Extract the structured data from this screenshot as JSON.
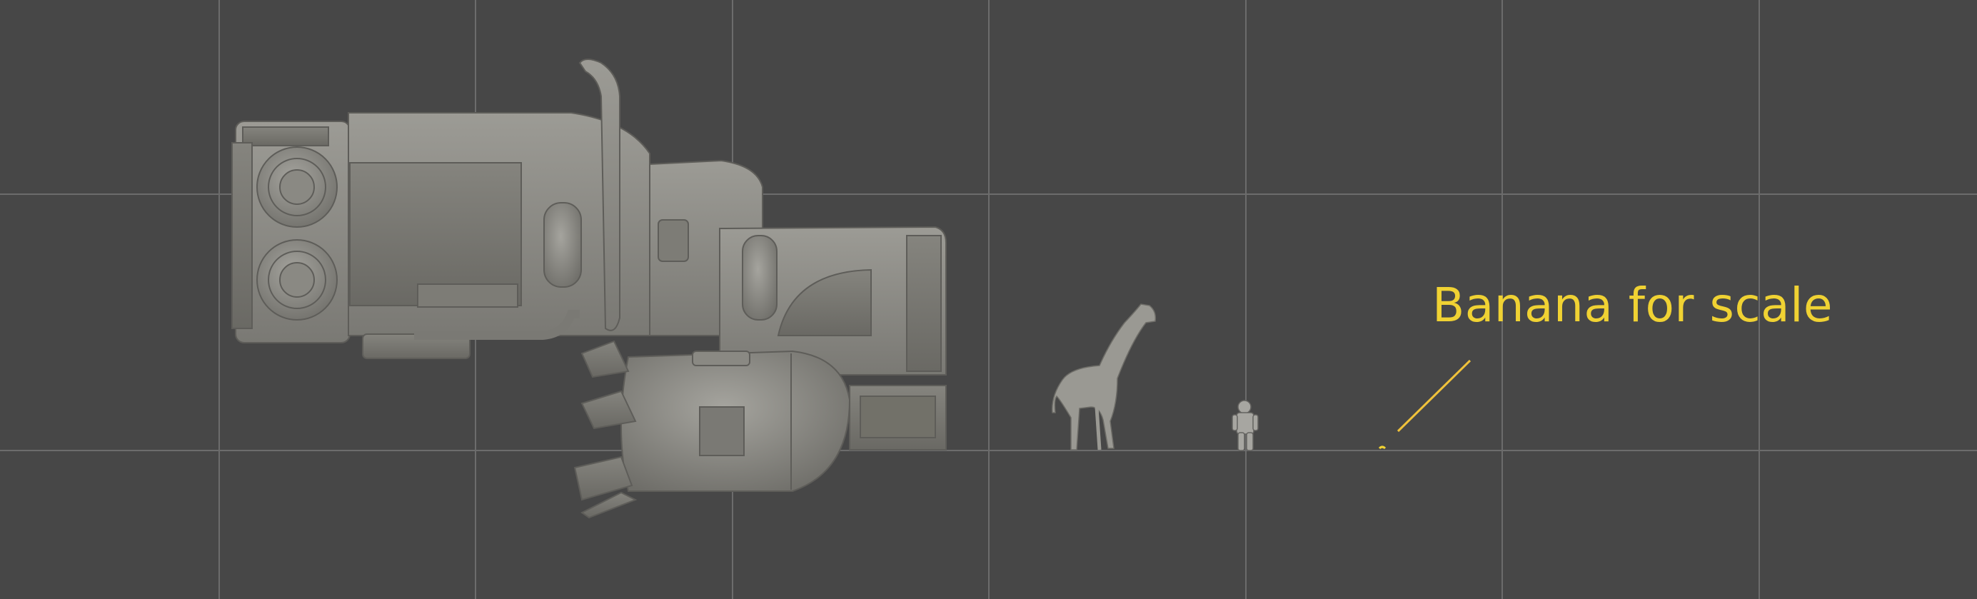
{
  "viewport": {
    "background_color": "#474747",
    "grid_color": "#6b6b6b",
    "model_color": "#8e8d87"
  },
  "annotation": {
    "label": "Banana for scale",
    "color": "#f0d233"
  },
  "scene_objects": [
    {
      "name": "vehicle",
      "icon": "sci-fi-vehicle-icon"
    },
    {
      "name": "giraffe",
      "icon": "giraffe-icon"
    },
    {
      "name": "astronaut",
      "icon": "astronaut-icon"
    },
    {
      "name": "banana",
      "icon": "banana-icon"
    }
  ]
}
